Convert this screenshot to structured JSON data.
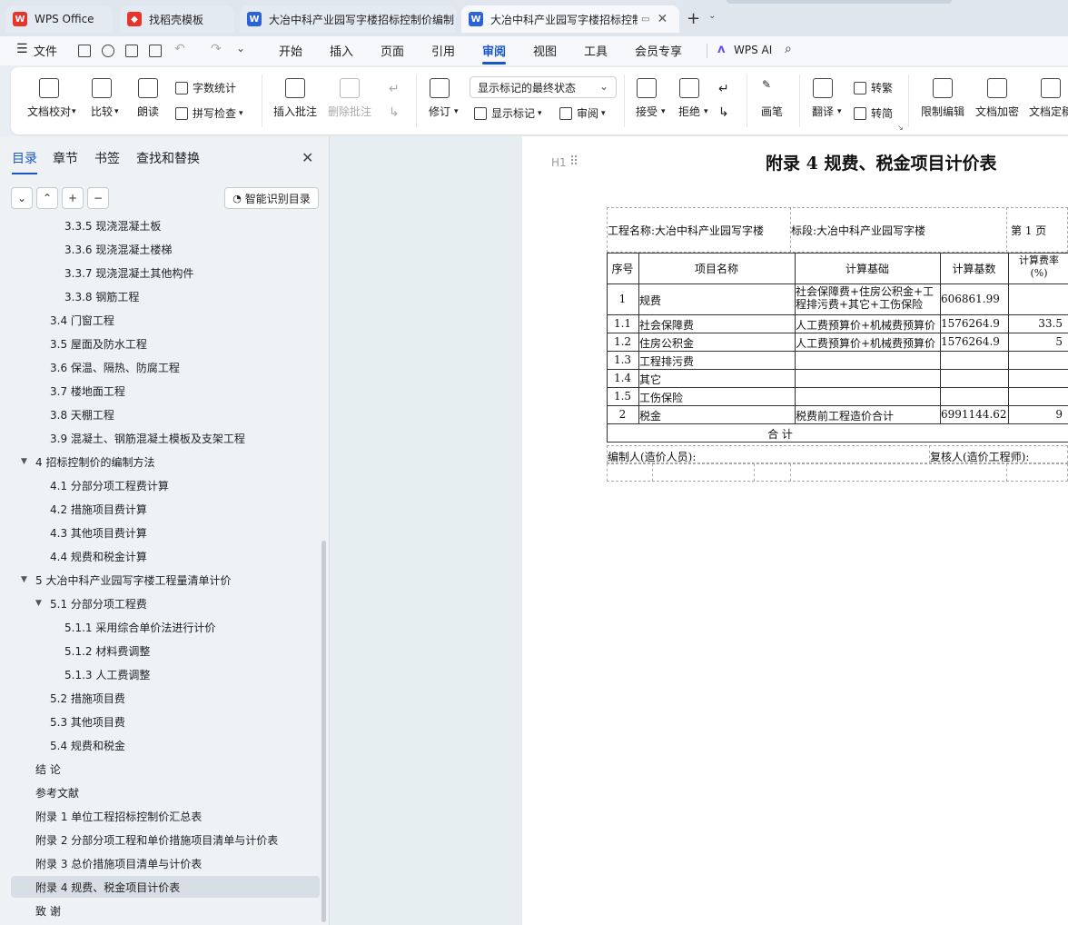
{
  "tabs": [
    {
      "label": "WPS Office",
      "active": false
    },
    {
      "label": "找稻壳模板",
      "active": false
    },
    {
      "label": "大冶中科产业园写字楼招标控制价编制",
      "active": false
    },
    {
      "label": "大冶中科产业园写字楼招标控制",
      "active": true
    }
  ],
  "menu": {
    "file": "文件",
    "items": [
      "开始",
      "插入",
      "页面",
      "引用",
      "审阅",
      "视图",
      "工具",
      "会员专享"
    ],
    "active": "审阅",
    "ai": "WPS AI"
  },
  "ribbon": {
    "doc_check": "文档校对",
    "compare": "比较",
    "read_aloud": "朗读",
    "word_count": "字数统计",
    "spell_check": "拼写检查",
    "insert_comment": "插入批注",
    "delete_comment": "删除批注",
    "revise": "修订",
    "markup_dropdown": "显示标记的最终状态",
    "show_markup": "显示标记",
    "review": "审阅",
    "accept": "接受",
    "reject": "拒绝",
    "pen": "画笔",
    "translate": "翻译",
    "to_traditional": "转繁",
    "to_simplified": "转简",
    "restrict_edit": "限制编辑",
    "encrypt": "文档加密",
    "finalize": "文档定稿"
  },
  "nav": {
    "tabs": [
      "目录",
      "章节",
      "书签",
      "查找和替换"
    ],
    "active_tab": "目录",
    "smart_toc": "智能识别目录",
    "items": [
      {
        "label": "3.3.5  现浇混凝土板",
        "level": 3
      },
      {
        "label": "3.3.6  现浇混凝土楼梯",
        "level": 3
      },
      {
        "label": "3.3.7  现浇混凝土其他构件",
        "level": 3
      },
      {
        "label": "3.3.8  钢筋工程",
        "level": 3
      },
      {
        "label": "3.4  门窗工程",
        "level": 2
      },
      {
        "label": "3.5  屋面及防水工程",
        "level": 2
      },
      {
        "label": "3.6  保温、隔热、防腐工程",
        "level": 2
      },
      {
        "label": "3.7  楼地面工程",
        "level": 2
      },
      {
        "label": "3.8  天棚工程",
        "level": 2
      },
      {
        "label": "3.9  混凝土、钢筋混凝土模板及支架工程",
        "level": 2
      },
      {
        "label": "4  招标控制价的编制方法",
        "level": 1,
        "caret": true
      },
      {
        "label": "4.1  分部分项工程费计算",
        "level": 2
      },
      {
        "label": "4.2  措施项目费计算",
        "level": 2
      },
      {
        "label": "4.3  其他项目费计算",
        "level": 2
      },
      {
        "label": "4.4  规费和税金计算",
        "level": 2
      },
      {
        "label": "5 大冶中科产业园写字楼工程量清单计价",
        "level": 1,
        "caret": true
      },
      {
        "label": "5.1  分部分项工程费",
        "level": 2,
        "caret": true
      },
      {
        "label": "5.1.1 采用综合单价法进行计价",
        "level": 3
      },
      {
        "label": "5.1.2 材料费调整",
        "level": 3
      },
      {
        "label": "5.1.3 人工费调整",
        "level": 3
      },
      {
        "label": "5.2  措施项目费",
        "level": 2
      },
      {
        "label": "5.3  其他项目费",
        "level": 2
      },
      {
        "label": "5.4  规费和税金",
        "level": 2
      },
      {
        "label": "结    论",
        "level": 1
      },
      {
        "label": "参考文献",
        "level": 1
      },
      {
        "label": "附录 1 单位工程招标控制价汇总表",
        "level": 1
      },
      {
        "label": "附录 2 分部分项工程和单价措施项目清单与计价表",
        "level": 1
      },
      {
        "label": "附录 3 总价措施项目清单与计价表",
        "level": 1
      },
      {
        "label": "附录 4 规费、税金项目计价表",
        "level": 1,
        "selected": true
      },
      {
        "label": "致    谢",
        "level": 1
      }
    ]
  },
  "document": {
    "heading_marker": "H1",
    "title": "附录 4 规费、税金项目计价表",
    "project_name": "工程名称:大冶中科产业园写字楼",
    "section": "标段:大冶中科产业园写字楼",
    "page": "第  1  页",
    "columns": [
      "序号",
      "项目名称",
      "计算基础",
      "计算基数",
      "计算费率(%)"
    ],
    "rows": [
      {
        "no": "1",
        "name": "规费",
        "basis": "社会保障费+住房公积金+工程排污费+其它+工伤保险",
        "base": "606861.99",
        "rate": ""
      },
      {
        "no": "1.1",
        "name": "社会保障费",
        "basis": "人工费预算价+机械费预算价",
        "base": "1576264.9",
        "rate": "33.5"
      },
      {
        "no": "1.2",
        "name": "住房公积金",
        "basis": "人工费预算价+机械费预算价",
        "base": "1576264.9",
        "rate": "5"
      },
      {
        "no": "1.3",
        "name": "工程排污费",
        "basis": "",
        "base": "",
        "rate": ""
      },
      {
        "no": "1.4",
        "name": "其它",
        "basis": "",
        "base": "",
        "rate": ""
      },
      {
        "no": "1.5",
        "name": "工伤保险",
        "basis": "",
        "base": "",
        "rate": ""
      },
      {
        "no": "2",
        "name": "税金",
        "basis": "税费前工程造价合计",
        "base": "6991144.62",
        "rate": "9"
      }
    ],
    "total_label": "合      计",
    "compiler": "编制人(造价人员):",
    "reviewer": "复核人(造价工程师):"
  }
}
